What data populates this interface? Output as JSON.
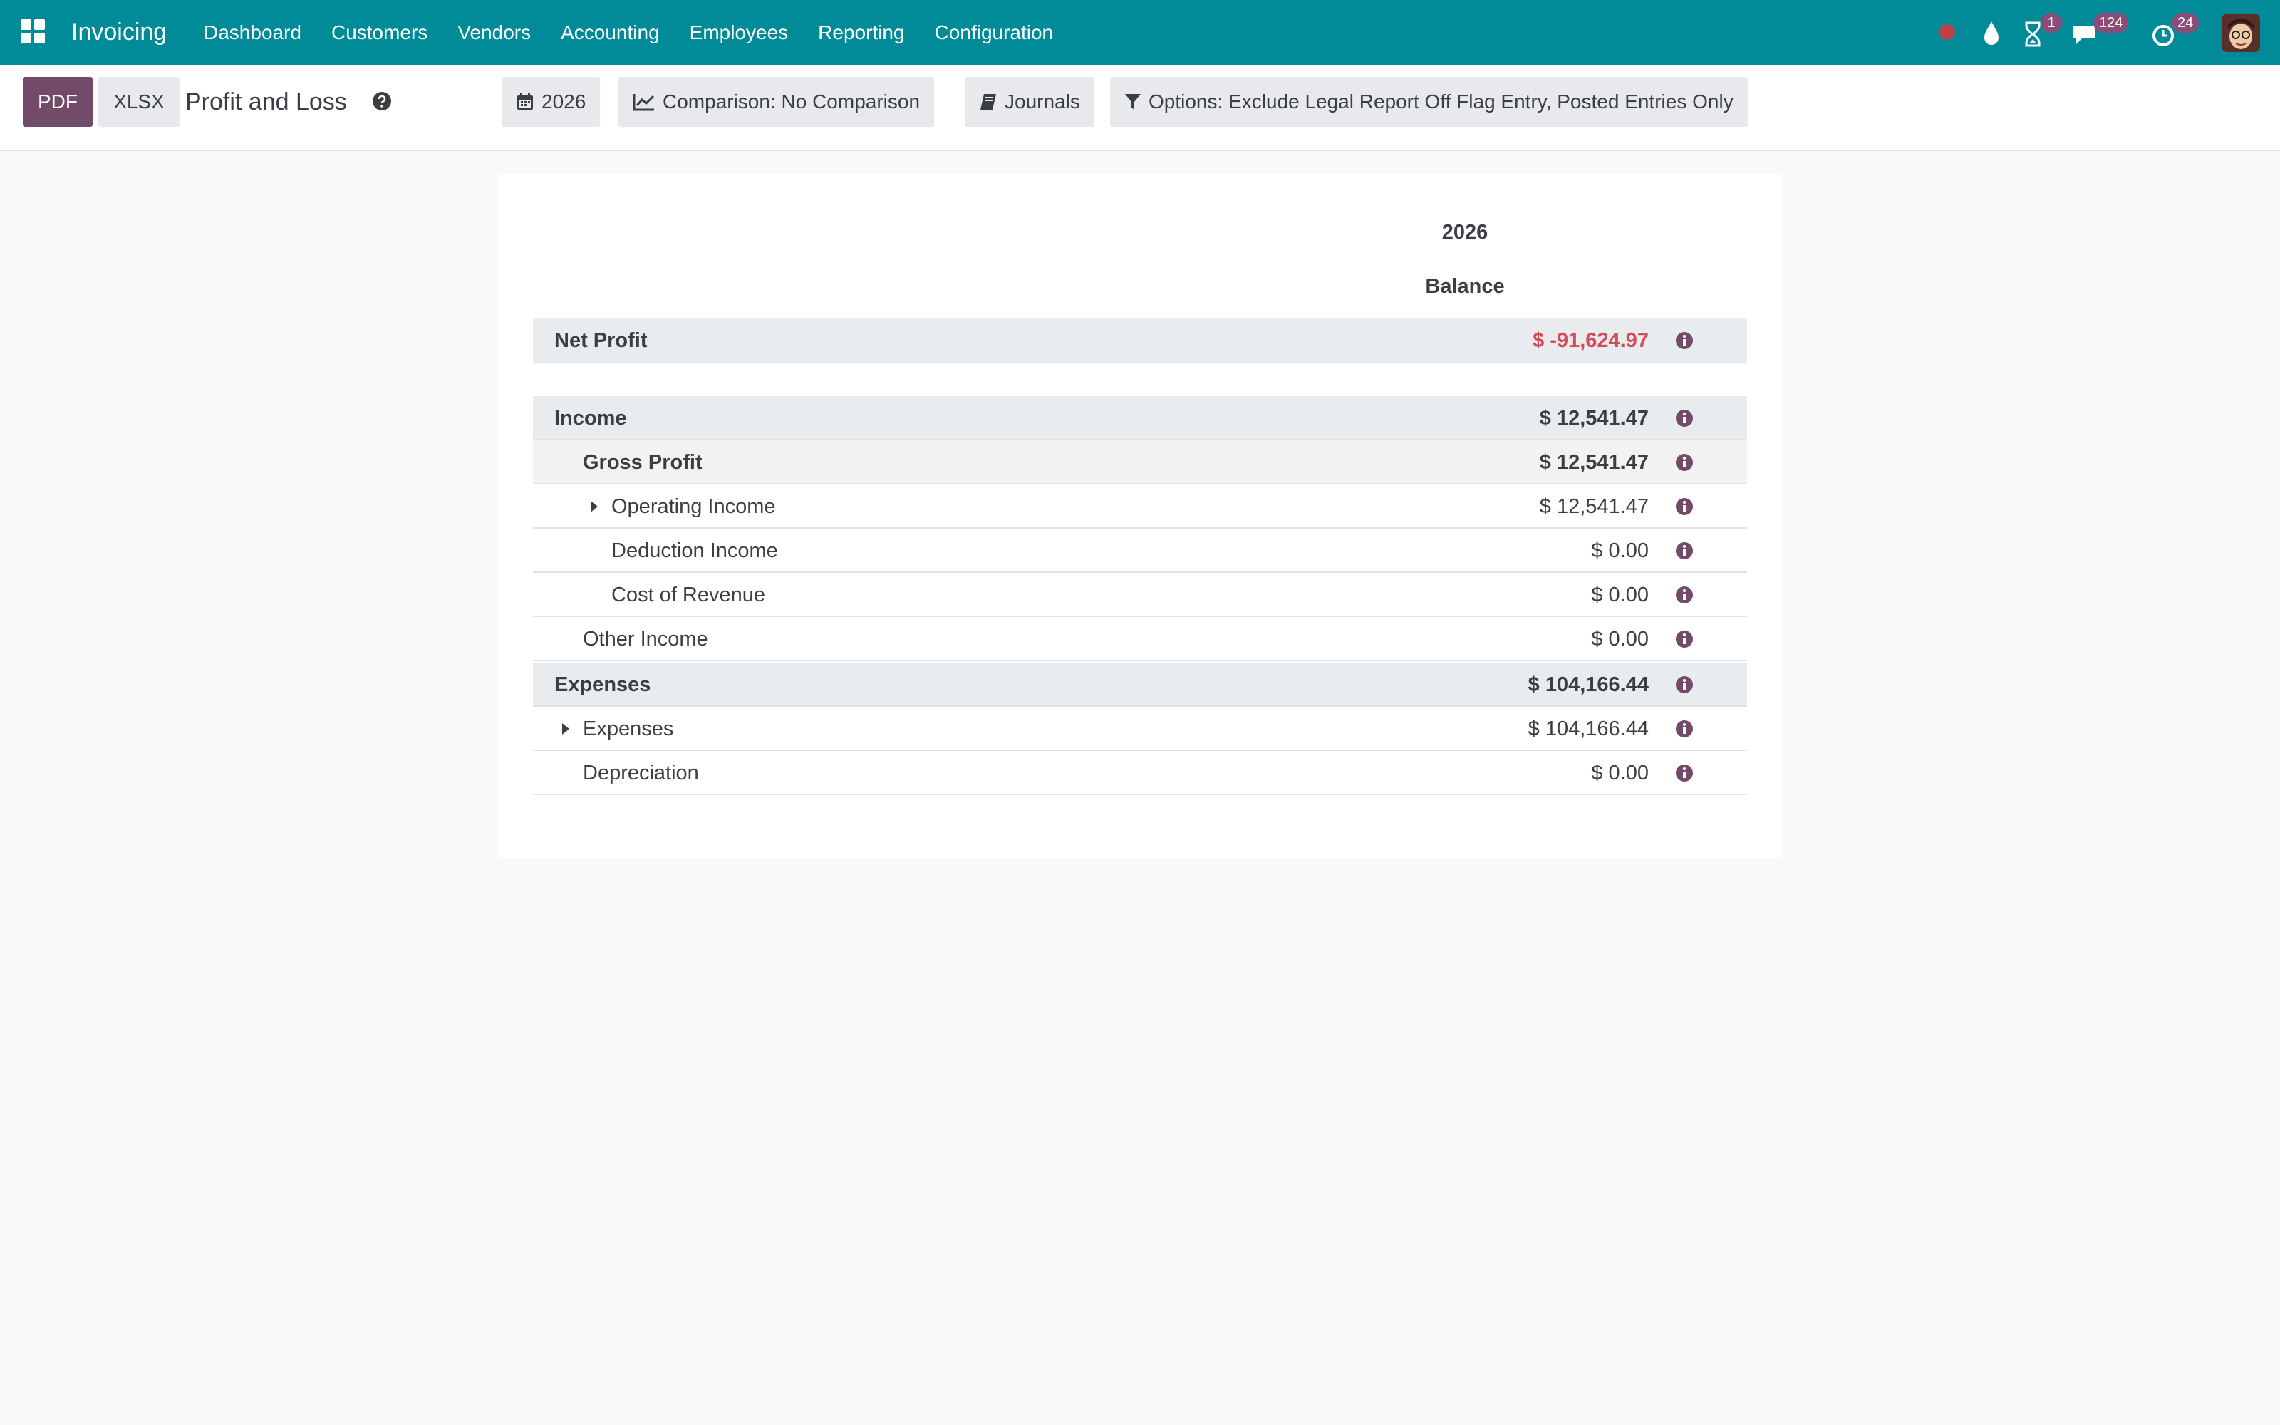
{
  "navbar": {
    "brand": "Invoicing",
    "menu": [
      "Dashboard",
      "Customers",
      "Vendors",
      "Accounting",
      "Employees",
      "Reporting",
      "Configuration"
    ],
    "badges": {
      "activity": "1",
      "messages": "124",
      "updates": "24"
    },
    "icons": [
      "apps-grid-icon",
      "record-dot-icon",
      "drop-icon",
      "hourglass-icon",
      "chat-icon",
      "clock-icon",
      "user-avatar"
    ],
    "color": "#018b98"
  },
  "control_panel": {
    "pdf_label": "PDF",
    "xlsx_label": "XLSX",
    "title": "Profit and Loss",
    "filters": {
      "period": "2026",
      "comparison": "Comparison: No Comparison",
      "journals": "Journals",
      "options": "Options: Exclude Legal Report Off Flag Entry, Posted Entries Only"
    }
  },
  "report": {
    "column_year": "2026",
    "column_label": "Balance",
    "rows": [
      {
        "label": "Net Profit",
        "amount": "$ -91,624.97"
      },
      {
        "label": "Income",
        "amount": "$ 12,541.47"
      },
      {
        "label": "Gross Profit",
        "amount": "$ 12,541.47"
      },
      {
        "label": "Operating Income",
        "amount": "$ 12,541.47"
      },
      {
        "label": "Deduction Income",
        "amount": "$ 0.00"
      },
      {
        "label": "Cost of Revenue",
        "amount": "$ 0.00"
      },
      {
        "label": "Other Income",
        "amount": "$ 0.00"
      },
      {
        "label": "Expenses",
        "amount": "$ 104,166.44"
      },
      {
        "label": "Expenses",
        "amount": "$ 104,166.44"
      },
      {
        "label": "Depreciation",
        "amount": "$ 0.00"
      }
    ],
    "colors": {
      "negative": "#d44c59",
      "info_icon": "#714b67"
    }
  }
}
